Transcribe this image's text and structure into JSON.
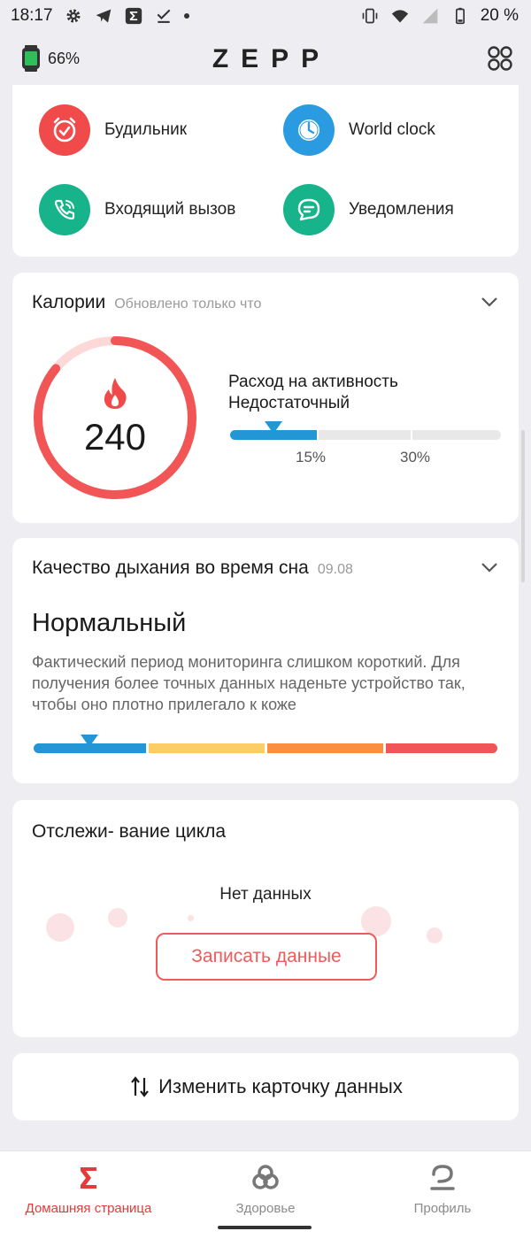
{
  "status_bar": {
    "time": "18:17",
    "battery_percent": "20 %",
    "icons_left": [
      "gear-icon",
      "telegram-icon",
      "zepp-sigma-icon",
      "checkmark-icon",
      "dot-icon"
    ],
    "icons_right": [
      "vibrate-icon",
      "wifi-icon",
      "signal-icon",
      "battery-icon"
    ]
  },
  "top_bar": {
    "device_battery": "66%",
    "brand": "ZEPP"
  },
  "shortcuts": [
    {
      "label": "Будильник",
      "icon": "alarm-clock-icon",
      "color": "#f04a4a"
    },
    {
      "label": "World clock",
      "icon": "clock-icon",
      "color": "#2a9be0"
    },
    {
      "label": "Входящий вызов",
      "icon": "phone-call-icon",
      "color": "#17b38a"
    },
    {
      "label": "Уведомления",
      "icon": "chat-bubble-icon",
      "color": "#17b38a"
    }
  ],
  "calories": {
    "title": "Калории",
    "updated": "Обновлено только что",
    "value": "240",
    "activity_label": "Расход на активность",
    "activity_status": "Недостаточный",
    "tick_15": "15%",
    "tick_30": "30%",
    "activity_fraction": 0.16,
    "ring_progress_fraction": 0.86,
    "accent": "#f25555"
  },
  "breathing": {
    "title": "Качество дыхания во время сна",
    "date": "09.08",
    "status": "Нормальный",
    "description": "Фактический период мониторинга слишком короткий. Для получения более точных данных наденьте устройство так, чтобы оно плотно прилегало к коже",
    "level_fraction": 0.12,
    "segment_colors": [
      "#2397d6",
      "#fccc66",
      "#fa8f3f",
      "#f25555"
    ]
  },
  "cycle": {
    "title": "Отслежи- вание цикла",
    "no_data": "Нет данных",
    "record_button": "Записать данные"
  },
  "edit_card": {
    "label": "Изменить карточку данных"
  },
  "bottom_nav": {
    "items": [
      {
        "label": "Домашняя страница",
        "icon": "sigma-home-icon",
        "active": true
      },
      {
        "label": "Здоровье",
        "icon": "health-knot-icon",
        "active": false
      },
      {
        "label": "Профиль",
        "icon": "profile-icon",
        "active": false
      }
    ]
  }
}
